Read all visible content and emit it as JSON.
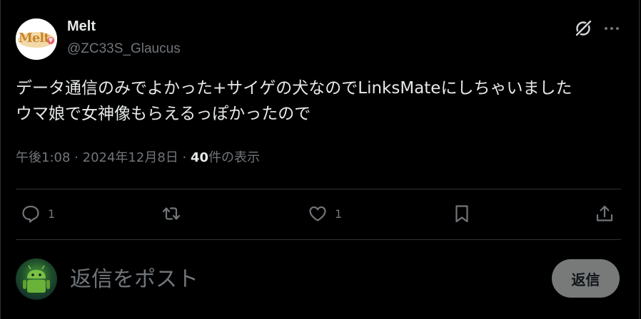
{
  "author": {
    "display_name": "Melt",
    "handle": "@ZC33S_Glaucus",
    "avatar_logo_text": "Melt"
  },
  "tweet": {
    "lines": [
      "データ通信のみでよかった+サイゲの犬なのでLinksMateにしちゃいました",
      "ウマ娘で女神像もらえるっぽかったので"
    ]
  },
  "meta": {
    "time": "午後1:08",
    "separator": "·",
    "date": "2024年12月8日",
    "views_count": "40",
    "views_label": "件の表示"
  },
  "actions": {
    "reply_count": "1",
    "like_count": "1",
    "icons": [
      "reply-icon",
      "retweet-icon",
      "like-icon",
      "bookmark-icon",
      "share-icon"
    ]
  },
  "composer": {
    "placeholder": "返信をポスト",
    "reply_button_label": "返信"
  },
  "colors": {
    "background": "#000000",
    "primary_text": "#e7e9ea",
    "secondary_text": "#71767b",
    "border": "#2f3336",
    "reply_button_bg": "#787a7a"
  }
}
